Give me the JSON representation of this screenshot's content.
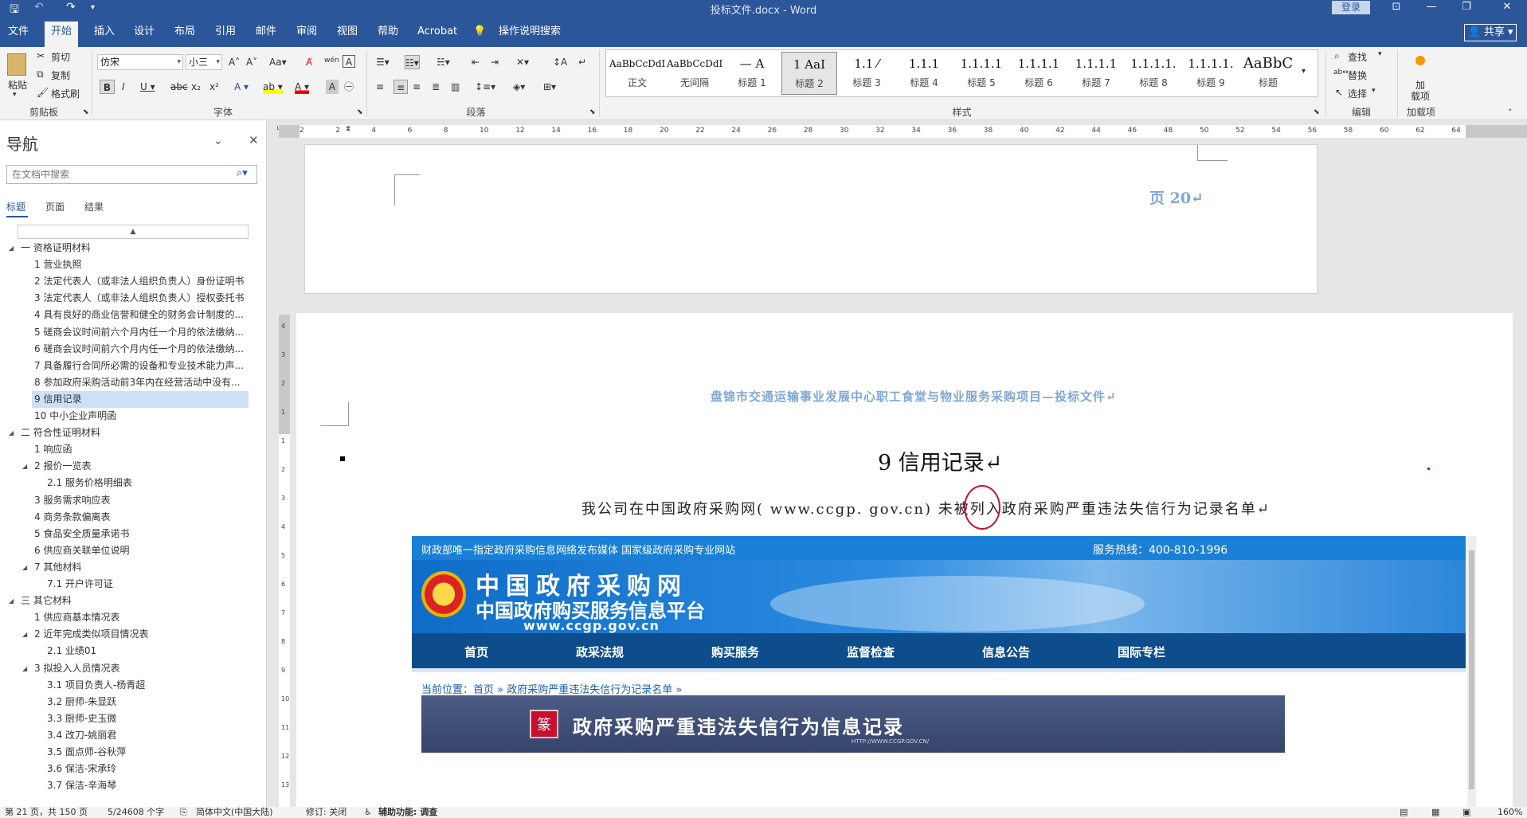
{
  "titlebar": {
    "document_title": "投标文件.docx  -  Word",
    "login_label": "登录",
    "min": "—",
    "restore": "❐",
    "close": "✕",
    "ribbon_opt": "⊡"
  },
  "tabs": [
    "文件",
    "开始",
    "插入",
    "设计",
    "布局",
    "引用",
    "邮件",
    "审阅",
    "视图",
    "帮助",
    "Acrobat",
    "操作说明搜索"
  ],
  "share_label": "共享",
  "ribbon": {
    "clipboard": {
      "paste": "粘贴",
      "cut": "剪切",
      "copy": "复制",
      "format_painter": "格式刷",
      "group": "剪贴板"
    },
    "font": {
      "family": "仿宋",
      "size": "小三",
      "group": "字体"
    },
    "paragraph": {
      "group": "段落"
    },
    "styles": {
      "group": "样式",
      "items": [
        {
          "preview": "AaBbCcDdI",
          "name": "正文"
        },
        {
          "preview": "AaBbCcDdI",
          "name": "无间隔"
        },
        {
          "preview": "— A",
          "name": "标题 1"
        },
        {
          "preview": "1  AaI",
          "name": "标题 2"
        },
        {
          "preview": "1.1  ⁄",
          "name": "标题 3"
        },
        {
          "preview": "1.1.1",
          "name": "标题 4"
        },
        {
          "preview": "1.1.1.1",
          "name": "标题 5"
        },
        {
          "preview": "1.1.1.1",
          "name": "标题 6"
        },
        {
          "preview": "1.1.1.1",
          "name": "标题 7"
        },
        {
          "preview": "1.1.1.1.",
          "name": "标题 8"
        },
        {
          "preview": "1.1.1.1.",
          "name": "标题 9"
        },
        {
          "preview": "AaBbC",
          "name": "标题"
        }
      ]
    },
    "editing": {
      "find": "查找",
      "replace": "替换",
      "select": "选择",
      "group": "编辑"
    },
    "addins": {
      "load": "加",
      "load2": "载项",
      "group": "加载项"
    }
  },
  "nav": {
    "title": "导航",
    "search_placeholder": "在文档中搜索",
    "tabs": [
      "标题",
      "页面",
      "结果"
    ],
    "items": [
      {
        "text": "一 资格证明材料",
        "level": 0,
        "exp": "◢"
      },
      {
        "text": "1 营业执照",
        "level": 1
      },
      {
        "text": "2 法定代表人（或非法人组织负责人）身份证明书",
        "level": 1
      },
      {
        "text": "3 法定代表人（或非法人组织负责人）授权委托书",
        "level": 1
      },
      {
        "text": "4 具有良好的商业信誉和健全的财务会计制度的...",
        "level": 1
      },
      {
        "text": "5 磋商会议时间前六个月内任一个月的依法缴纳...",
        "level": 1
      },
      {
        "text": "6 磋商会议时间前六个月内任一个月的依法缴纳...",
        "level": 1
      },
      {
        "text": "7 具备履行合同所必需的设备和专业技术能力声...",
        "level": 1
      },
      {
        "text": "8 参加政府采购活动前3年内在经营活动中没有...",
        "level": 1
      },
      {
        "text": "9 信用记录",
        "level": 1,
        "selected": true
      },
      {
        "text": "10 中小企业声明函",
        "level": 1
      },
      {
        "text": "二 符合性证明材料",
        "level": 0,
        "exp": "◢"
      },
      {
        "text": "1 响应函",
        "level": 1
      },
      {
        "text": "2 报价一览表",
        "level": 1,
        "exp": "◢"
      },
      {
        "text": "2.1 服务价格明细表",
        "level": 2
      },
      {
        "text": "3 服务需求响应表",
        "level": 1
      },
      {
        "text": "4 商务条款偏离表",
        "level": 1
      },
      {
        "text": "5  食品安全质量承诺书",
        "level": 1
      },
      {
        "text": "6 供应商关联单位说明",
        "level": 1
      },
      {
        "text": "7 其他材料",
        "level": 1,
        "exp": "◢"
      },
      {
        "text": "7.1 开户许可证",
        "level": 2
      },
      {
        "text": "三 其它材料",
        "level": 0,
        "exp": "◢"
      },
      {
        "text": "1 供应商基本情况表",
        "level": 1
      },
      {
        "text": "2 近年完成类似项目情况表",
        "level": 1,
        "exp": "◢"
      },
      {
        "text": "2.1 业绩01",
        "level": 2
      },
      {
        "text": "3 拟投入人员情况表",
        "level": 1,
        "exp": "◢"
      },
      {
        "text": "3.1 项目负责人-杨青超",
        "level": 2
      },
      {
        "text": "3.2 厨师-朱显跃",
        "level": 2
      },
      {
        "text": "3.3 厨师-史玉微",
        "level": 2
      },
      {
        "text": "3.4 改刀-姚丽君",
        "level": 2
      },
      {
        "text": "3.5 面点师-谷秋萍",
        "level": 2
      },
      {
        "text": "3.6 保洁-宋承玲",
        "level": 2
      },
      {
        "text": "3.7 保洁-辛海琴",
        "level": 2
      }
    ]
  },
  "ruler": {
    "ticks": [
      "2",
      "2",
      "4",
      "6",
      "8",
      "10",
      "12",
      "14",
      "16",
      "18",
      "20",
      "22",
      "24",
      "26",
      "28",
      "30",
      "32",
      "34",
      "36",
      "38",
      "40",
      "42",
      "44",
      "46",
      "48",
      "50",
      "52",
      "54",
      "56",
      "58",
      "60",
      "62",
      "64"
    ],
    "vticks": [
      "4",
      "3",
      "2",
      "1",
      "1",
      "2",
      "3",
      "4",
      "5",
      "6",
      "7",
      "8",
      "9",
      "10",
      "11",
      "12",
      "13"
    ]
  },
  "doc": {
    "page_label": "页 20↵",
    "header_text": "盘锦市交通运输事业发展中心职工食堂与物业服务采购项目—投标文件↵",
    "heading": "9  信用记录↵",
    "body_line": "我公司在中国政府采购网( www.ccgp. gov.cn) 未被列入政府采购严重违法失信行为记录名单↵",
    "ccgp": {
      "top_left": "财政部唯一指定政府采购信息网络发布媒体 国家级政府采购专业网站",
      "hotline": "服务热线：400-810-1996",
      "logo_line1": "中国政府采购网",
      "logo_line2": "中国政府购买服务信息平台",
      "logo_url": "www.ccgp.gov.cn",
      "menu": [
        "首页",
        "政采法规",
        "购买服务",
        "监督检查",
        "信息公告",
        "国际专栏"
      ],
      "breadcrumb": "当前位置：首页 » 政府采购严重违法失信行为记录名单 »",
      "banner_title": "政府采购严重违法失信行为信息记录",
      "banner_url": "HTTP://WWW.CCGP.GOV.CN/",
      "banner_icon": "篆",
      "colors": {
        "blue": "#1a7fd6",
        "navy": "#0d4d8c",
        "banner": "#3a4a72",
        "red": "#c8102e"
      }
    }
  },
  "status": {
    "page": "第 21 页，共 150 页",
    "words": "5/24608 个字",
    "lang": "简体中文(中国大陆)",
    "track": "修订: 关闭",
    "access": "辅助功能: 调查",
    "zoom": "160%"
  }
}
